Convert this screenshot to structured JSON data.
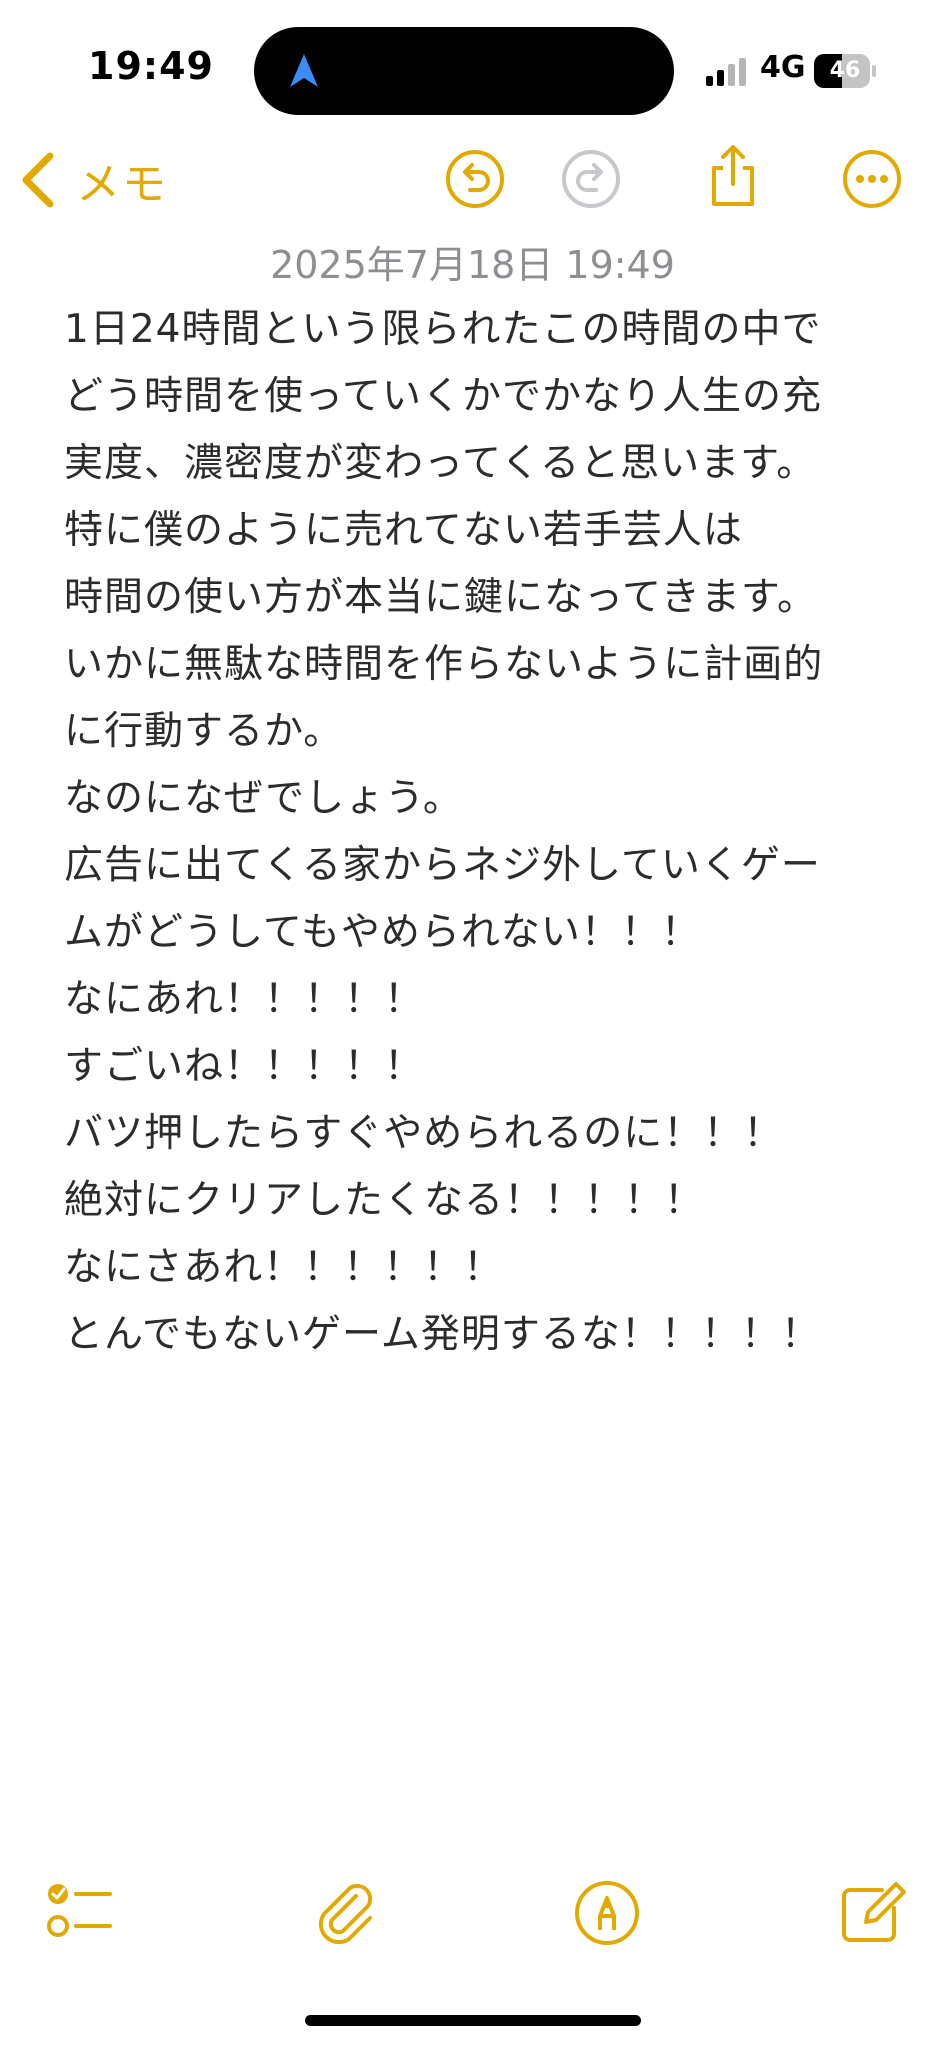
{
  "status_bar": {
    "time": "19:49",
    "network": "4G",
    "battery": "46"
  },
  "nav": {
    "back_label": "メモ"
  },
  "note": {
    "date": "2025年7月18日 19:49",
    "lines": [
      "1日24時間という限られたこの時間の中で",
      "どう時間を使っていくかでかなり人生の充",
      "実度、濃密度が変わってくると思います。",
      "特に僕のように売れてない若手芸人は",
      "時間の使い方が本当に鍵になってきます。",
      "いかに無駄な時間を作らないように計画的",
      "に行動するか。",
      "なのになぜでしょう。",
      "広告に出てくる家からネジ外していくゲー",
      "ムがどうしてもやめられない！！！",
      "なにあれ！！！！！",
      "すごいね！！！！！",
      "バツ押したらすぐやめられるのに！！！",
      "絶対にクリアしたくなる！！！！！",
      "なにさあれ！！！！！！",
      "とんでもないゲーム発明するな！！！！！"
    ]
  },
  "colors": {
    "accent": "#e2a900",
    "disabled": "#c7c7cc",
    "text": "#2c2c2e",
    "date": "#8e8e93"
  },
  "icons": {
    "back": "chevron-left-icon",
    "undo": "undo-icon",
    "redo": "redo-icon",
    "share": "share-icon",
    "more": "more-icon",
    "checklist": "checklist-icon",
    "attachment": "paperclip-icon",
    "markup": "markup-pen-icon",
    "compose": "compose-icon"
  }
}
